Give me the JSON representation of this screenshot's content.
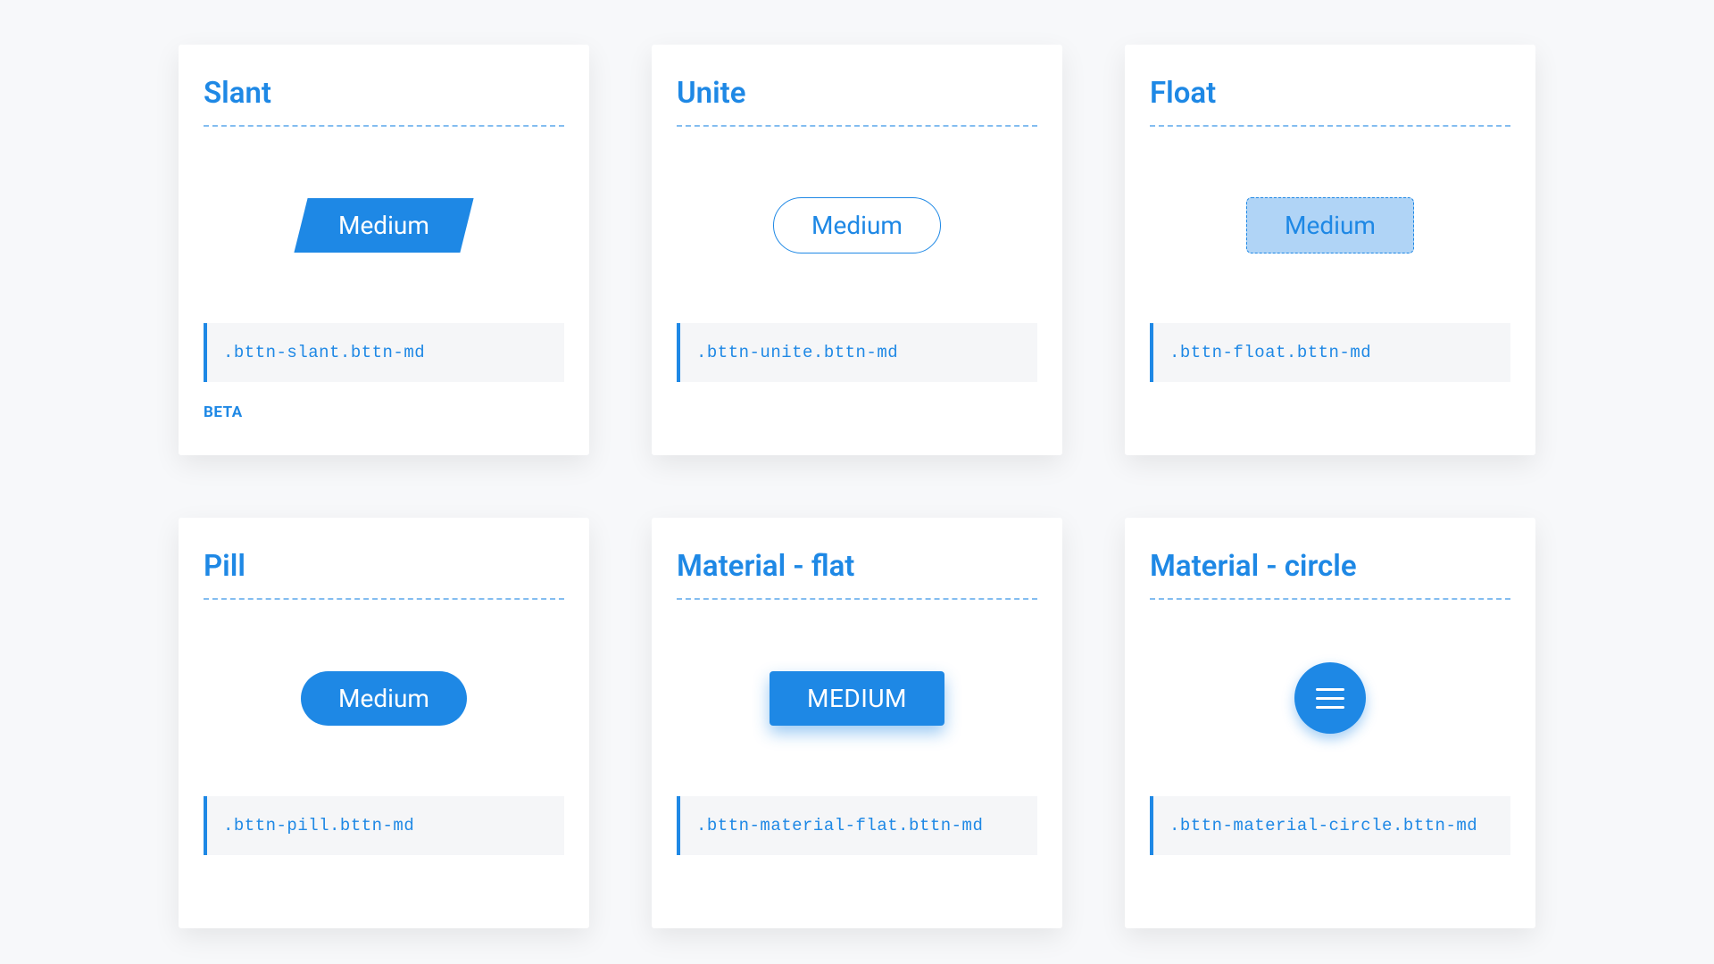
{
  "primary_color": "#1e88e5",
  "cards": [
    {
      "title": "Slant",
      "button_label": "Medium",
      "class_code": ".bttn-slant.bttn-md",
      "variant": "slant",
      "badge": "BETA"
    },
    {
      "title": "Unite",
      "button_label": "Medium",
      "class_code": ".bttn-unite.bttn-md",
      "variant": "unite",
      "badge": null
    },
    {
      "title": "Float",
      "button_label": "Medium",
      "class_code": ".bttn-float.bttn-md",
      "variant": "float",
      "badge": null
    },
    {
      "title": "Pill",
      "button_label": "Medium",
      "class_code": ".bttn-pill.bttn-md",
      "variant": "pill",
      "badge": null
    },
    {
      "title": "Material - flat",
      "button_label": "MEDIUM",
      "class_code": ".bttn-material-flat.bttn-md",
      "variant": "matflat",
      "badge": null
    },
    {
      "title": "Material - circle",
      "button_label": "",
      "class_code": ".bttn-material-circle.bttn-md",
      "variant": "matcircle",
      "badge": null,
      "icon": "menu-icon"
    }
  ]
}
